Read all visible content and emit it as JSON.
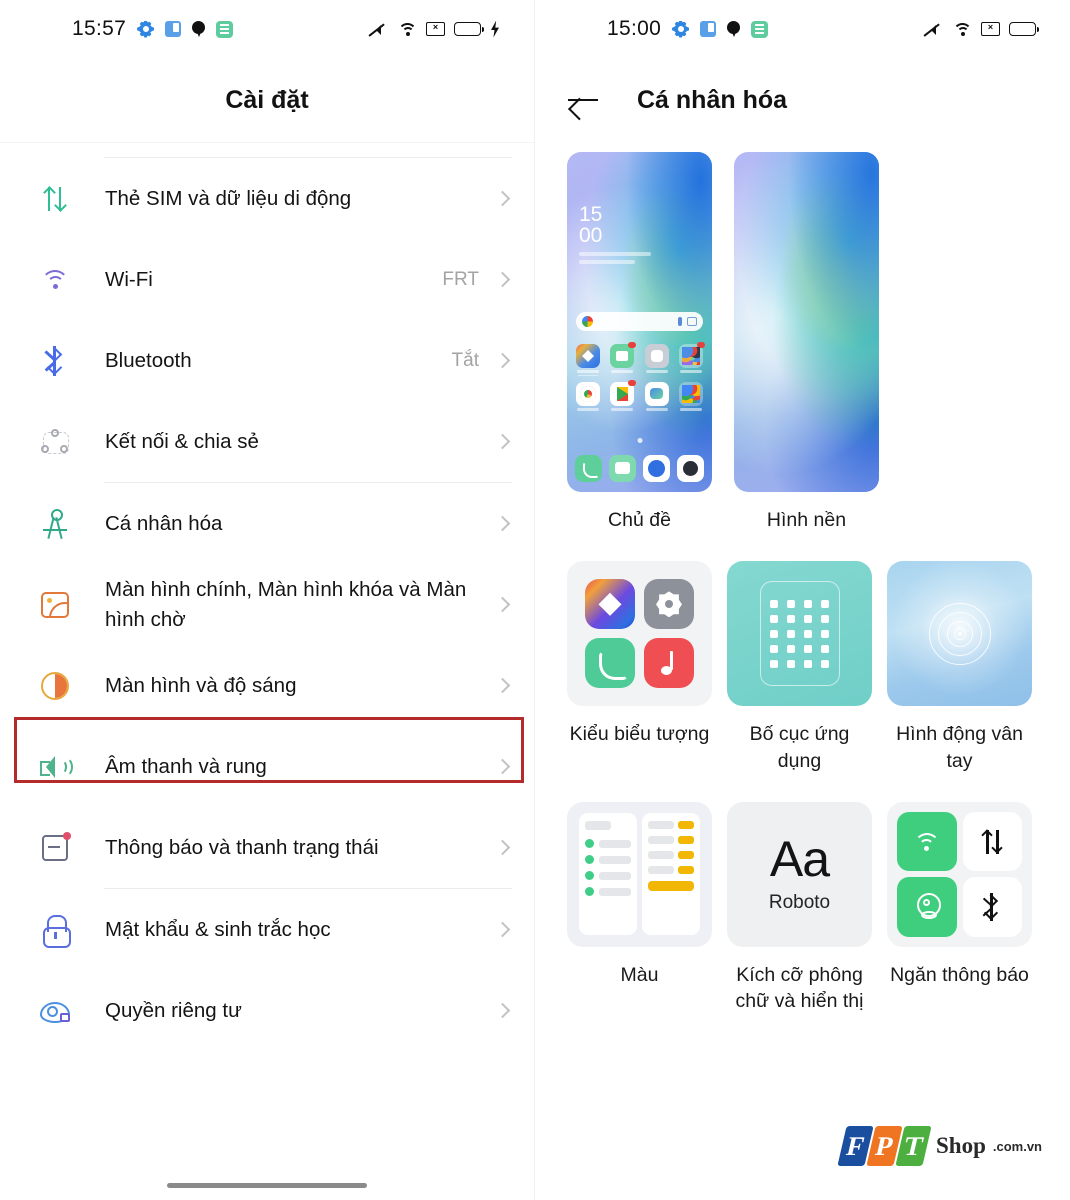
{
  "left_screen": {
    "statusbar": {
      "time": "15:57",
      "icons_left": [
        "gear-icon",
        "app-icon",
        "location-pin-icon",
        "green-app-icon"
      ],
      "icons_right": [
        "mute-icon",
        "wifi-icon",
        "x-box-icon",
        "battery-icon",
        "charging-bolt-icon"
      ]
    },
    "title": "Cài đặt",
    "items": [
      {
        "icon": "sim-card-icon",
        "label": "Thẻ SIM và dữ liệu di động",
        "value": ""
      },
      {
        "icon": "wifi-icon",
        "label": "Wi-Fi",
        "value": "FRT"
      },
      {
        "icon": "bluetooth-icon",
        "label": "Bluetooth",
        "value": "Tắt"
      },
      {
        "icon": "connection-share-icon",
        "label": "Kết nối & chia sẻ",
        "value": ""
      },
      {
        "icon": "personalization-icon",
        "label": "Cá nhân hóa",
        "value": "",
        "highlighted": true
      },
      {
        "icon": "home-screen-icon",
        "label": "Màn hình chính, Màn hình khóa và Màn hình chờ",
        "value": ""
      },
      {
        "icon": "brightness-icon",
        "label": "Màn hình và độ sáng",
        "value": ""
      },
      {
        "icon": "sound-icon",
        "label": "Âm thanh và rung",
        "value": ""
      },
      {
        "icon": "notification-icon",
        "label": "Thông báo và thanh trạng thái",
        "value": ""
      },
      {
        "icon": "lock-icon",
        "label": "Mật khẩu & sinh trắc học",
        "value": ""
      },
      {
        "icon": "privacy-eye-icon",
        "label": "Quyền riêng tư",
        "value": ""
      }
    ],
    "highlight_color": "#b32b2b"
  },
  "right_screen": {
    "statusbar": {
      "time": "15:00",
      "icons_left": [
        "gear-icon",
        "app-icon",
        "location-pin-icon",
        "green-app-icon"
      ],
      "icons_right": [
        "mute-icon",
        "wifi-icon",
        "x-box-icon",
        "battery-icon"
      ]
    },
    "back_icon": "back-arrow-icon",
    "title": "Cá nhân hóa",
    "big_cells": [
      {
        "label": "Chủ đề",
        "preview": "theme-home-screen-preview",
        "clock": {
          "hour": "15",
          "minute": "00"
        }
      },
      {
        "label": "Hình nền",
        "preview": "wallpaper-preview"
      }
    ],
    "small_cells": [
      {
        "label": "Kiểu biểu tượng",
        "preview": "icon-style-preview"
      },
      {
        "label": "Bố cục ứng dụng",
        "preview": "app-layout-preview"
      },
      {
        "label": "Hình động vân tay",
        "preview": "fingerprint-animation-preview"
      },
      {
        "label": "Màu",
        "preview": "color-preview"
      },
      {
        "label": "Kích cỡ phông chữ và hiển thị",
        "preview": "font-size-preview",
        "sample": "Aa",
        "font_name": "Roboto"
      },
      {
        "label": "Ngăn thông báo",
        "preview": "notification-panel-preview"
      }
    ],
    "quick_toggles": [
      {
        "icon": "wifi-icon",
        "state": "on"
      },
      {
        "icon": "mobile-data-icon",
        "state": "off"
      },
      {
        "icon": "location-icon",
        "state": "on"
      },
      {
        "icon": "bluetooth-icon",
        "state": "off"
      }
    ]
  },
  "watermark": {
    "letters": [
      "F",
      "P",
      "T"
    ],
    "shop": "Shop",
    "domain": ".com.vn",
    "colors": {
      "f": "#1a4fa0",
      "p": "#f07522",
      "t": "#4caf3f"
    }
  }
}
